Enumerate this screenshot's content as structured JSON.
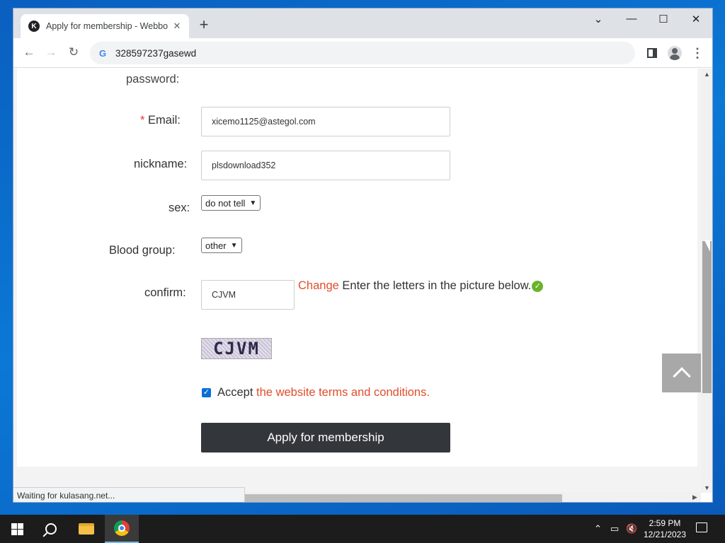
{
  "browser": {
    "tab_title": "Apply for membership - Webboa",
    "tab_favicon_letter": "K",
    "url": "328597237gasewd",
    "status_text": "Waiting for kulasang.net..."
  },
  "form": {
    "password_label": "password:",
    "email": {
      "required_mark": "*",
      "label": "Email:",
      "value": "xicemo1125@astegol.com"
    },
    "nickname": {
      "label": "nickname:",
      "value": "plsdownload352"
    },
    "sex": {
      "label": "sex:",
      "selected": "do not tell"
    },
    "blood_group": {
      "label": "Blood group:",
      "selected": "other"
    },
    "confirm": {
      "label": "confirm:",
      "value": "CJVM",
      "change_link": "Change",
      "hint": "Enter the letters in the picture below."
    },
    "captcha_text": "CJVM",
    "accept": {
      "checked": true,
      "text": "Accept",
      "terms_link": "the website terms and conditions."
    },
    "submit_label": "Apply for membership"
  },
  "taskbar": {
    "time": "2:59 PM",
    "date": "12/21/2023"
  },
  "colors": {
    "link_red": "#e04e2b",
    "submit_bg": "#33363b",
    "desktop_blue": "#0b78d6"
  }
}
